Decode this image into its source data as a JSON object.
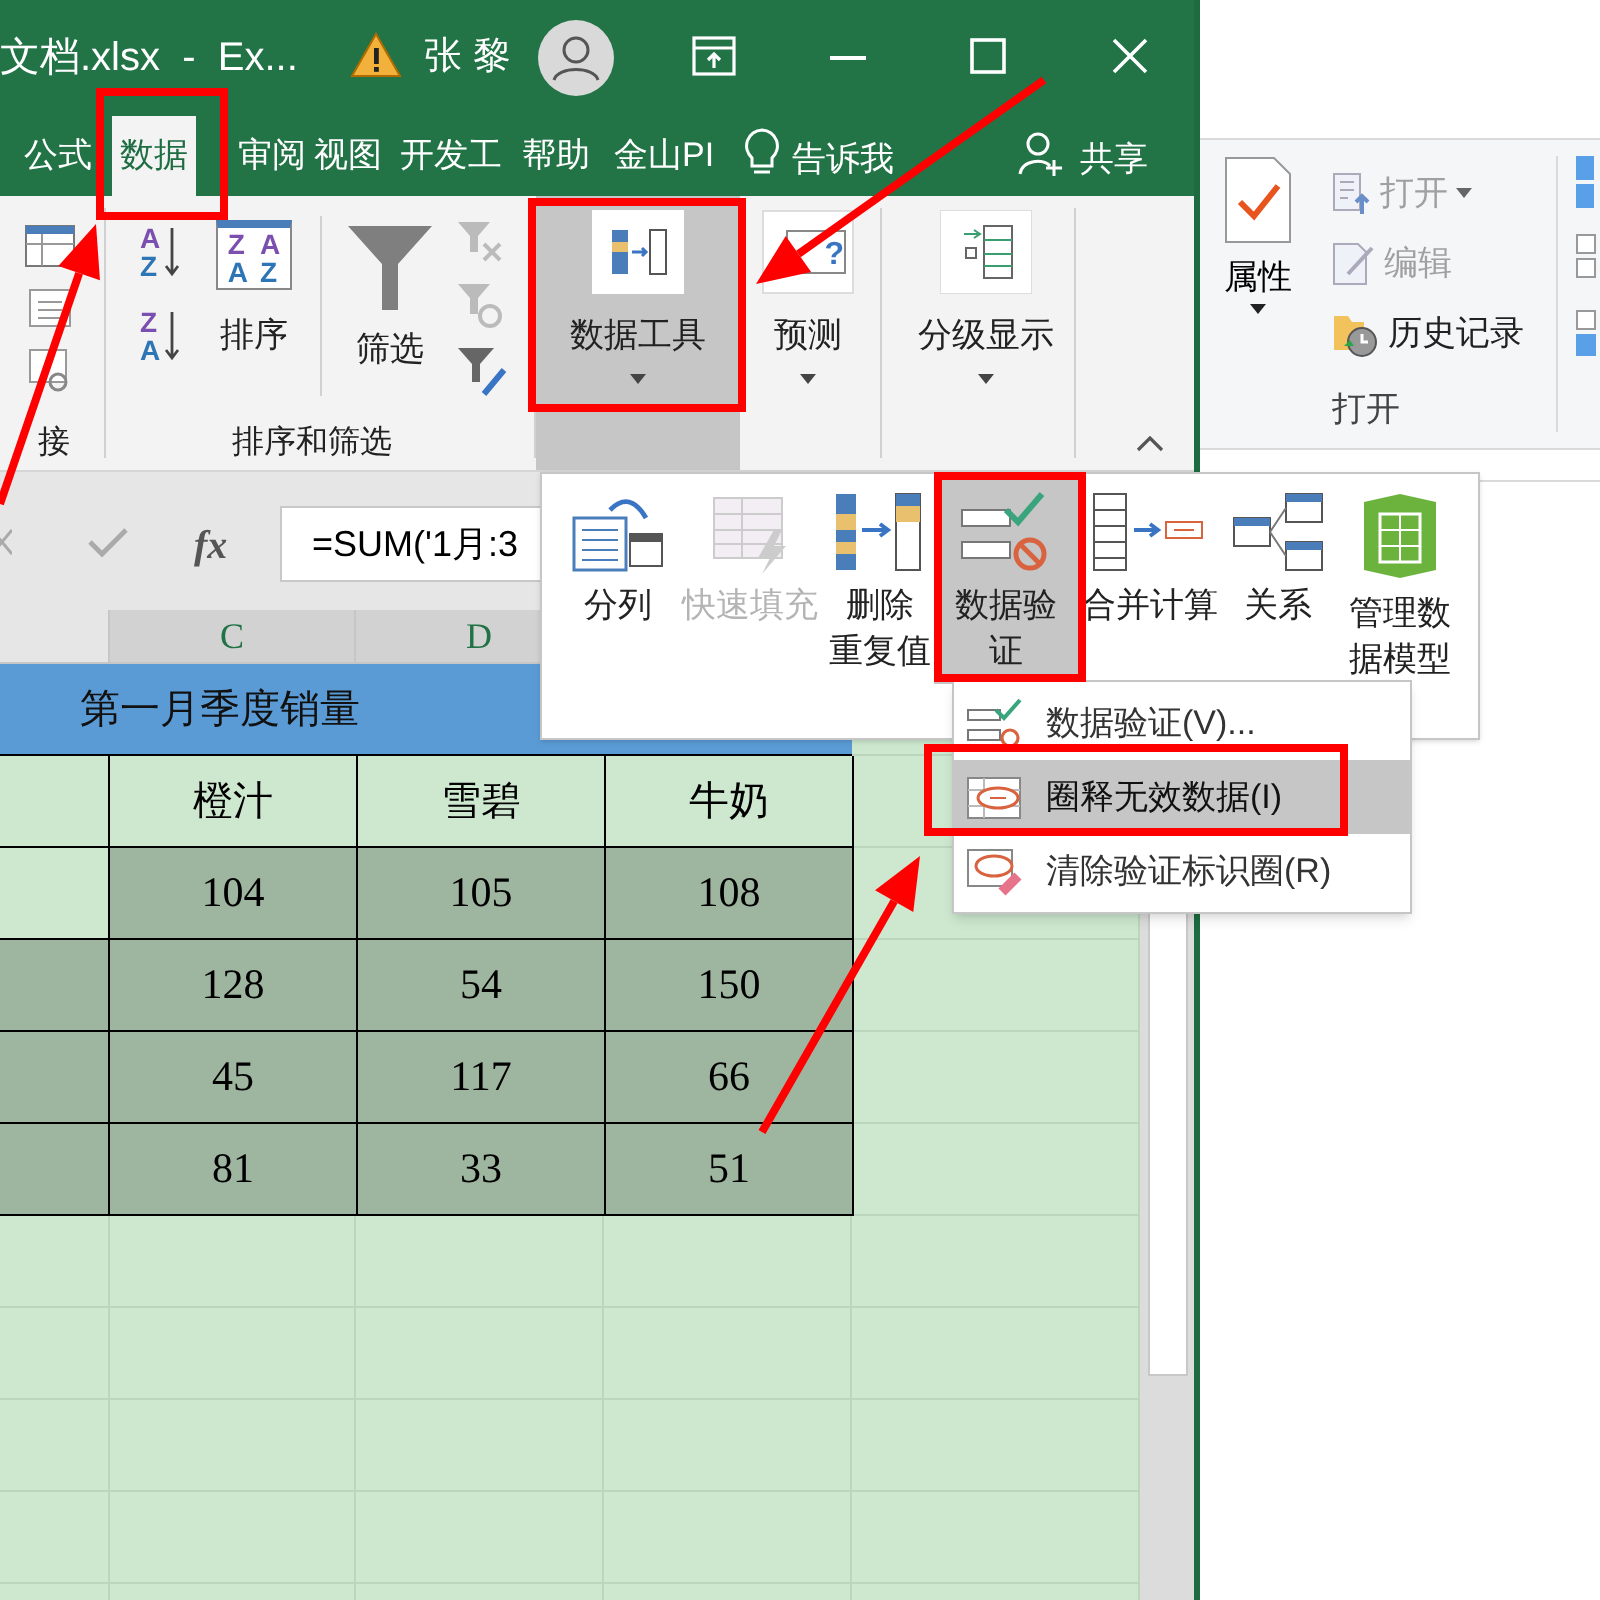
{
  "window": {
    "title": "文档.xlsx  -  Ex...",
    "user": "张 黎"
  },
  "tabs": [
    {
      "label": "公式",
      "selected": false
    },
    {
      "label": "数据",
      "selected": true
    },
    {
      "label": "审阅",
      "selected": false
    },
    {
      "label": "视图",
      "selected": false
    },
    {
      "label": "开发工",
      "selected": false
    },
    {
      "label": "帮助",
      "selected": false
    },
    {
      "label": "金山PI",
      "selected": false
    }
  ],
  "tell_me": "告诉我",
  "share": "共享",
  "ribbon": {
    "connections_label": "接",
    "sort_ascending_icon": [
      "A",
      "Z"
    ],
    "sort_descending_icon": [
      "Z",
      "A"
    ],
    "sort_icon": [
      "Z",
      "A",
      "A",
      "Z"
    ],
    "sort_button": "排序",
    "filter_button": "筛选",
    "sort_filter_label": "排序和筛选",
    "data_tools": {
      "label": "数据工具",
      "expanded": true
    },
    "forecast": {
      "label": "预测",
      "expanded": false,
      "icon_mark": "?"
    },
    "outline": {
      "label": "分级显示",
      "expanded": false
    }
  },
  "formula_bar": {
    "function_button": "fx",
    "formula": "=SUM('1月:3"
  },
  "columns": [
    {
      "label": "C",
      "selected": true
    },
    {
      "label": "D",
      "selected": true
    }
  ],
  "sheet": {
    "title": "第一月季度销量",
    "headers": [
      "橙汁",
      "雪碧",
      "牛奶"
    ],
    "rows": [
      {
        "selected": true,
        "active": true,
        "cells": [
          "104",
          "105",
          "108"
        ]
      },
      {
        "selected": true,
        "active": false,
        "cells": [
          "128",
          "54",
          "150"
        ]
      },
      {
        "selected": true,
        "active": false,
        "cells": [
          "45",
          "117",
          "66"
        ]
      },
      {
        "selected": true,
        "active": false,
        "cells": [
          "81",
          "33",
          "51"
        ]
      }
    ]
  },
  "data_tools_panel": [
    {
      "kind": "split",
      "lines": [
        "分列"
      ],
      "disabled": false,
      "expanded": false
    },
    {
      "kind": "flash",
      "lines": [
        "快速填充"
      ],
      "disabled": true,
      "expanded": false
    },
    {
      "kind": "dedupe",
      "lines": [
        "删除",
        "重复值"
      ],
      "disabled": false,
      "expanded": false
    },
    {
      "kind": "validate",
      "lines": [
        "数据验",
        "证"
      ],
      "disabled": false,
      "expanded": true
    },
    {
      "kind": "consolidate",
      "lines": [
        "合并计算"
      ],
      "disabled": false,
      "expanded": false
    },
    {
      "kind": "relations",
      "lines": [
        "关系"
      ],
      "disabled": false,
      "expanded": false
    },
    {
      "kind": "model",
      "lines": [
        "管理数",
        "据模型"
      ],
      "disabled": false,
      "expanded": false
    }
  ],
  "validation_menu": [
    {
      "kind": "validate",
      "label": "数据验证(V)...",
      "selected": false
    },
    {
      "kind": "circle",
      "label": "圈释无效数据(I)",
      "selected": true
    },
    {
      "kind": "clear",
      "label": "清除验证标识圈(R)",
      "selected": false
    }
  ],
  "explorer": {
    "properties": "属性",
    "commands": [
      {
        "kind": "open",
        "label": "打开",
        "disabled": true
      },
      {
        "kind": "edit",
        "label": "编辑",
        "disabled": true
      },
      {
        "kind": "history",
        "label": "历史记录",
        "disabled": false
      }
    ],
    "group_label": "打开"
  }
}
